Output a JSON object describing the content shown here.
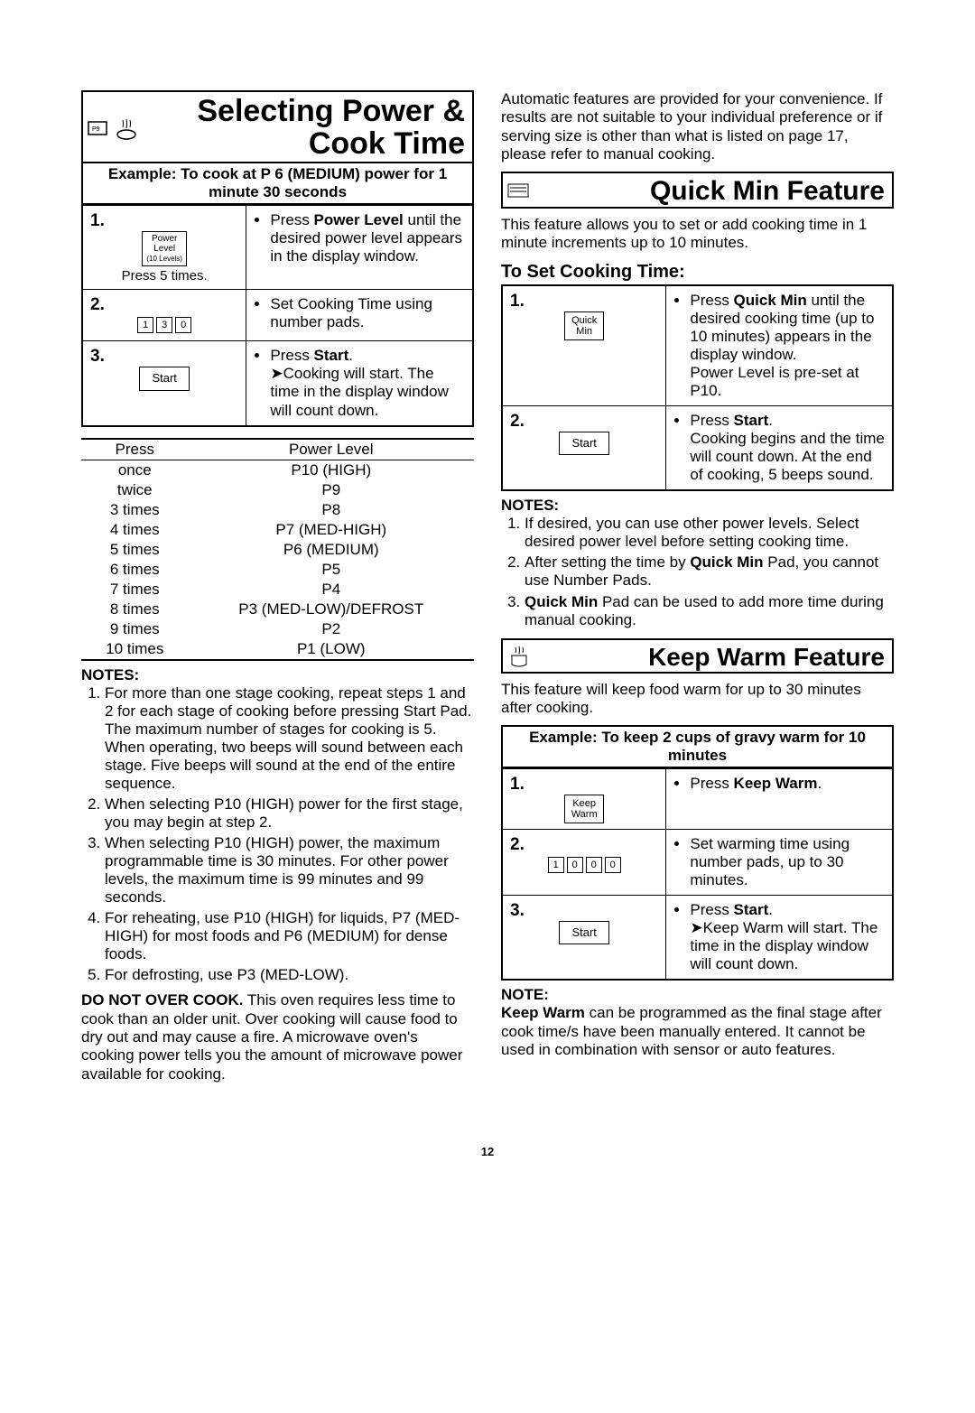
{
  "pageNumber": "12",
  "left": {
    "header": "Selecting Power & Cook Time",
    "example": "Example: To cook at P 6 (MEDIUM) power for 1 minute 30 seconds",
    "step1": {
      "btnLine1": "Power",
      "btnLine2": "Level",
      "btnLine3": "(10 Levels)",
      "caption": "Press 5 times.",
      "text1": "Press ",
      "text1b": "Power Level",
      "text1c": " until the desired power level appears in the display window."
    },
    "step2": {
      "d1": "1",
      "d2": "3",
      "d3": "0",
      "text": "Set Cooking Time using number pads."
    },
    "step3": {
      "btn": "Start",
      "text1": "Press ",
      "text1b": "Start",
      "text1c": ".",
      "text2": "➤Cooking will start. The time in the display window will count down."
    },
    "plHead1": "Press",
    "plHead2": "Power Level",
    "pl": [
      [
        "once",
        "P10 (HIGH)"
      ],
      [
        "twice",
        "P9"
      ],
      [
        "3 times",
        "P8"
      ],
      [
        "4 times",
        "P7 (MED-HIGH)"
      ],
      [
        "5 times",
        "P6 (MEDIUM)"
      ],
      [
        "6 times",
        "P5"
      ],
      [
        "7 times",
        "P4"
      ],
      [
        "8 times",
        "P3 (MED-LOW)/DEFROST"
      ],
      [
        "9 times",
        "P2"
      ],
      [
        "10 times",
        "P1 (LOW)"
      ]
    ],
    "notesLabel": "NOTES:",
    "notes": [
      "For more than one stage cooking, repeat steps 1 and 2 for each stage of cooking before pressing Start Pad. The maximum number of stages for cooking is 5. When operating, two beeps will sound between each stage. Five beeps will sound at the end of the entire sequence.",
      "When selecting P10 (HIGH) power for the first stage, you may begin at step 2.",
      "When selecting P10 (HIGH) power, the maximum programmable time is 30 minutes. For other power levels, the maximum time is 99 minutes and 99 seconds.",
      "For reheating, use P10 (HIGH) for liquids, P7 (MED-HIGH) for most foods and P6 (MEDIUM) for dense foods.",
      "For defrosting, use P3 (MED-LOW)."
    ],
    "doNotOverCookBold": "DO NOT OVER COOK.",
    "doNotOverCook": " This oven requires less time to cook than an older unit. Over cooking will cause food to dry out and may cause a fire. A microwave oven's cooking power tells you the amount of microwave power available for cooking."
  },
  "right": {
    "autoPara": "Automatic features are provided for your convenience. If results are not suitable to your individual preference or if serving size is other than what is listed on page 17, please refer to manual cooking.",
    "qmHeader": "Quick Min Feature",
    "qmIntro": "This feature allows you to set or add cooking time in 1 minute increments up to 10 minutes.",
    "qmSub": "To Set Cooking Time:",
    "qmStep1": {
      "btnLine1": "Quick",
      "btnLine2": "Min",
      "text1": "Press ",
      "text1b": "Quick Min",
      "text1c": " until the desired cooking time (up to 10 minutes) appears in the display window.",
      "text2": "Power Level is pre-set at P10."
    },
    "qmStep2": {
      "btn": "Start",
      "text1": "Press ",
      "text1b": "Start",
      "text1c": ".",
      "text2": "Cooking begins and the time will count down. At the end of cooking, 5 beeps sound."
    },
    "qmNotesLabel": "NOTES:",
    "qmNotes": [
      "If desired, you can use other power levels. Select desired power level before setting cooking time.",
      "After setting the time by Quick Min Pad, you cannot use Number Pads.",
      "Quick Min Pad can be used to add more time during manual cooking."
    ],
    "qmNote2a": "After setting the time by ",
    "qmNote2b": "Quick Min",
    "qmNote2c": " Pad, you cannot use Number Pads.",
    "qmNote3a": "Quick Min",
    "qmNote3b": " Pad can be used to add more time during manual cooking.",
    "kwHeader": "Keep Warm Feature",
    "kwIntro": "This feature will keep food warm for up to 30 minutes after cooking.",
    "kwExample": "Example: To keep 2 cups of gravy warm for 10 minutes",
    "kwStep1": {
      "btnLine1": "Keep",
      "btnLine2": "Warm",
      "text1": "Press ",
      "text1b": "Keep Warm",
      "text1c": "."
    },
    "kwStep2": {
      "d1": "1",
      "d2": "0",
      "d3": "0",
      "d4": "0",
      "text": "Set warming time using number pads, up to 30 minutes."
    },
    "kwStep3": {
      "btn": "Start",
      "text1": "Press ",
      "text1b": "Start",
      "text1c": ".",
      "text2": "➤Keep Warm will start. The time in the display window will count down."
    },
    "kwNoteLabel": "NOTE:",
    "kwNoteBold": "Keep Warm",
    "kwNote": " can be programmed as the final stage after cook time/s have been manually entered. It cannot be used in combination with sensor or auto features."
  }
}
